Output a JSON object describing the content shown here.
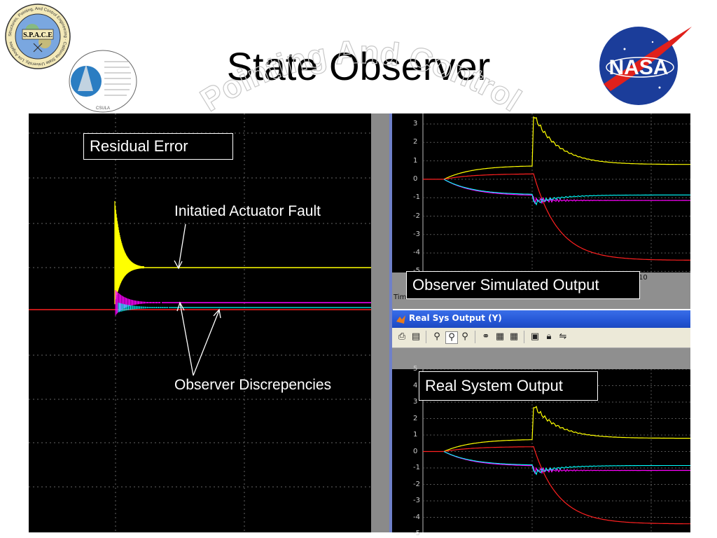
{
  "slide": {
    "title": "State Observer",
    "watermark_text": "Pointing And Control"
  },
  "logos": {
    "space_logo_text": "S.P.A.C.E",
    "space_ring_text": "Structures, Pointing, And Control Engineering · California State University, Los Angeles",
    "lab_seal_text": "CSULA",
    "nasa_text": "NASA"
  },
  "left_plot": {
    "residual_label": "Residual Error",
    "fault_label": "Initatied Actuator Fault",
    "discrepancies_label": "Observer Discrepencies"
  },
  "top_right_plot": {
    "label": "Observer Simulated Output",
    "y_ticks": [
      "3",
      "2",
      "1",
      "0",
      "-1",
      "-2",
      "-3",
      "-4",
      "-5"
    ],
    "x_tick_partial": "10",
    "time_partial": "Tim"
  },
  "window": {
    "title": "Real Sys Output (Y)",
    "toolbar_icons": [
      "print-icon",
      "print-preview-icon",
      "zoom-in-icon",
      "zoom-out-icon",
      "pan-icon",
      "binoculars-icon",
      "params-icon",
      "params2-icon",
      "save-icon",
      "lock-icon",
      "autoscale-icon"
    ]
  },
  "bottom_right_plot": {
    "label": "Real System Output",
    "y_ticks": [
      "5",
      "4",
      "3",
      "2",
      "1",
      "0",
      "-1",
      "-2",
      "-3",
      "-4",
      "-5"
    ]
  },
  "colors": {
    "plot_bg": "#000000",
    "yellow": "#ffff00",
    "magenta": "#ff00ff",
    "cyan": "#00ffff",
    "red": "#ff2020",
    "window_title_blue": "#2456d6"
  }
}
